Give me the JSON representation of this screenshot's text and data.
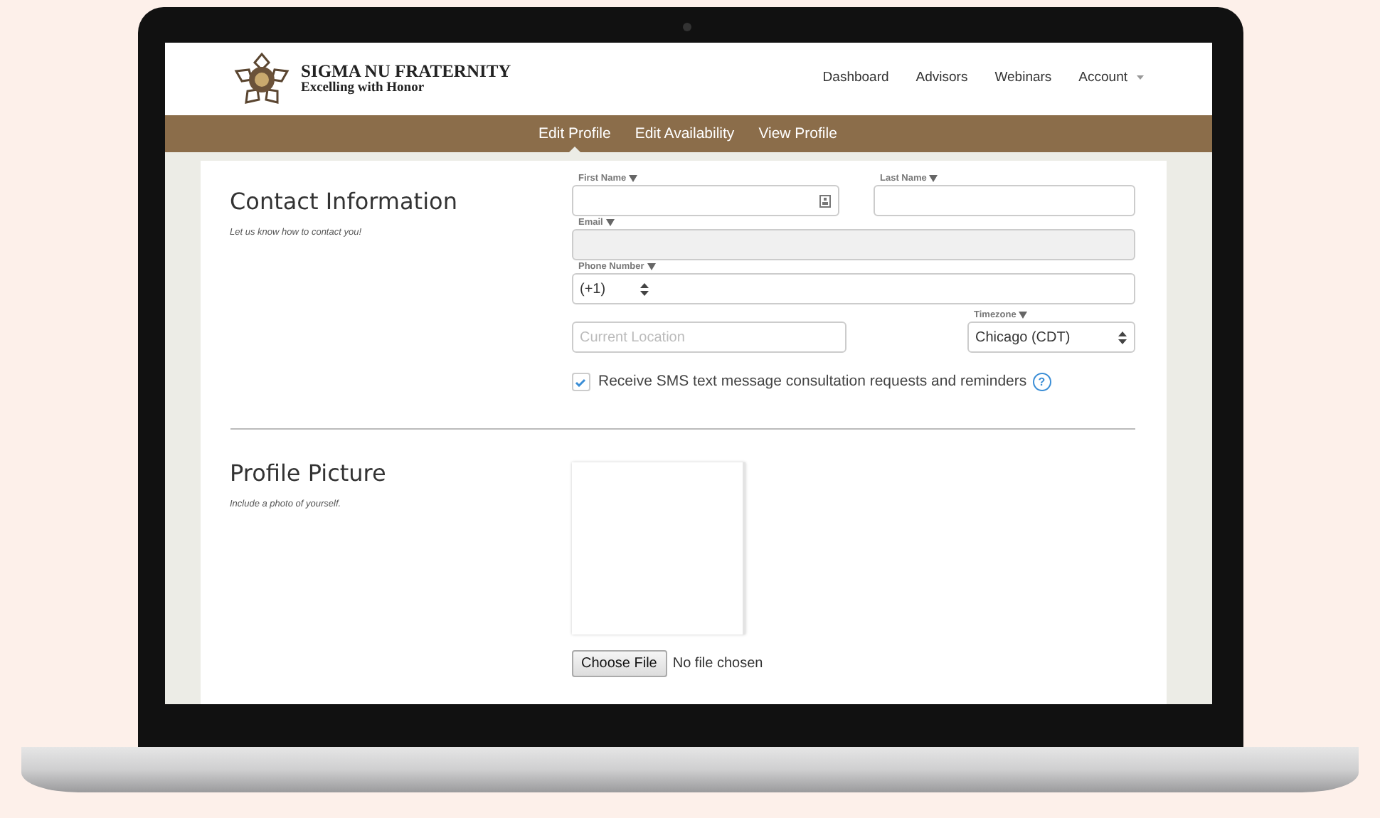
{
  "brand": {
    "title": "SIGMA NU FRATERNITY",
    "tagline": "Excelling with Honor"
  },
  "nav": [
    {
      "label": "Dashboard",
      "dropdown": false
    },
    {
      "label": "Advisors",
      "dropdown": false
    },
    {
      "label": "Webinars",
      "dropdown": false
    },
    {
      "label": "Account",
      "dropdown": true
    }
  ],
  "tabs": [
    {
      "label": "Edit Profile",
      "selected": true
    },
    {
      "label": "Edit Availability",
      "selected": false
    },
    {
      "label": "View Profile",
      "selected": false
    }
  ],
  "contact": {
    "title": "Contact Information",
    "subtitle": "Let us know how to contact you!",
    "first_name": {
      "label": "First Name"
    },
    "last_name": {
      "label": "Last Name"
    },
    "email": {
      "label": "Email",
      "disabled": true
    },
    "phone": {
      "label": "Phone Number",
      "country_code": "(+1)"
    },
    "location": {
      "placeholder": "Current Location"
    },
    "timezone": {
      "label": "Timezone",
      "value": "Chicago (CDT)"
    },
    "sms": {
      "label": "Receive SMS text message consultation requests and reminders",
      "checked": true,
      "help": "?"
    }
  },
  "picture": {
    "title": "Profile Picture",
    "subtitle": "Include a photo of yourself.",
    "file_button": "Choose File",
    "file_status": "No file chosen"
  }
}
